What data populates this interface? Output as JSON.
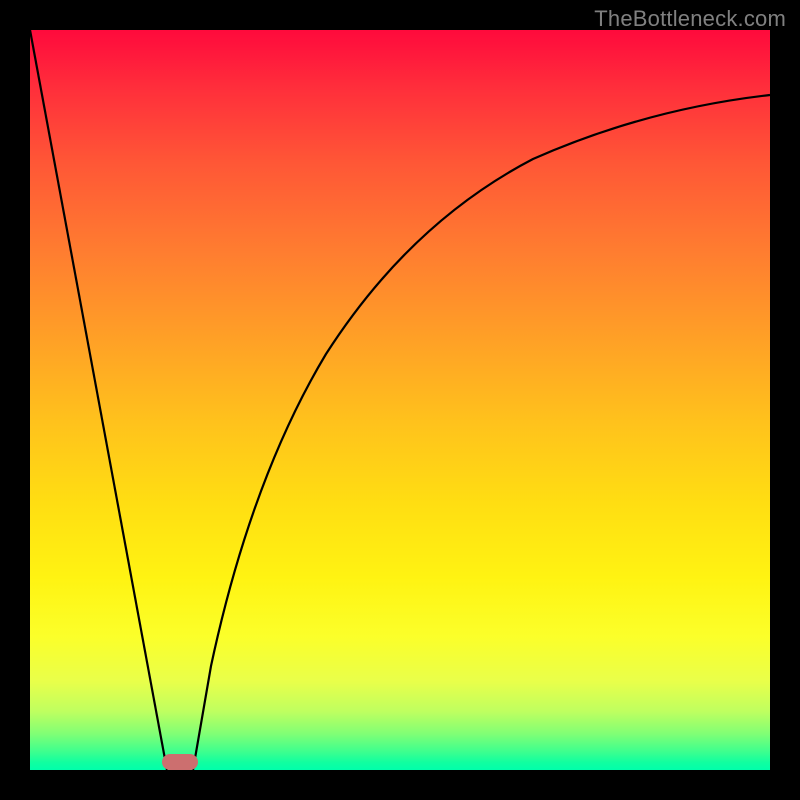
{
  "watermark": "TheBottleneck.com",
  "chart_data": {
    "type": "line",
    "title": "",
    "xlabel": "",
    "ylabel": "",
    "xlim": [
      0,
      1
    ],
    "ylim": [
      0,
      1
    ],
    "grid": false,
    "legend": false,
    "series": [
      {
        "name": "left-line",
        "x": [
          0.0,
          0.185
        ],
        "values": [
          1.0,
          0.0
        ]
      },
      {
        "name": "right-curve",
        "x": [
          0.22,
          0.245,
          0.275,
          0.31,
          0.35,
          0.395,
          0.445,
          0.5,
          0.56,
          0.625,
          0.695,
          0.77,
          0.85,
          0.925,
          1.0
        ],
        "values": [
          0.0,
          0.14,
          0.26,
          0.37,
          0.465,
          0.55,
          0.625,
          0.69,
          0.745,
          0.79,
          0.828,
          0.858,
          0.882,
          0.899,
          0.912
        ]
      }
    ],
    "marker": {
      "name": "optimal-point",
      "x": 0.203,
      "y": 0.0,
      "color": "#cc6f6f"
    },
    "background_gradient": {
      "top": "#ff0a3c",
      "bottom": "#00ffab"
    }
  }
}
